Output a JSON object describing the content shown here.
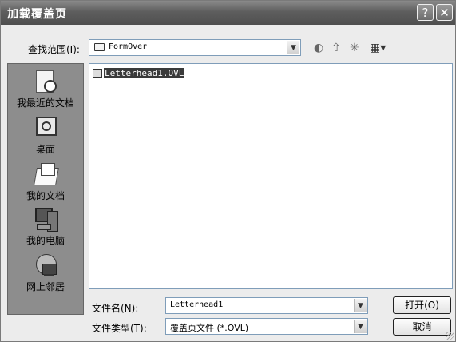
{
  "window": {
    "title": "加载覆盖页",
    "help_label": "?",
    "close_label": "✕"
  },
  "lookin": {
    "label": "查找范围(I):",
    "value": "FormOver"
  },
  "toolbar": {
    "back_glyph": "◐",
    "up_glyph": "⇧",
    "newfolder_glyph": "✳",
    "views_glyph": "▦▾"
  },
  "places": [
    {
      "label": "我最近的文档",
      "icon": "recent-documents-icon"
    },
    {
      "label": "桌面",
      "icon": "desktop-icon"
    },
    {
      "label": "我的文档",
      "icon": "my-documents-icon"
    },
    {
      "label": "我的电脑",
      "icon": "my-computer-icon"
    },
    {
      "label": "网上邻居",
      "icon": "network-places-icon"
    }
  ],
  "files": [
    {
      "name": "Letterhead1.OVL"
    }
  ],
  "filename": {
    "label": "文件名(N):",
    "value": "Letterhead1"
  },
  "filetype": {
    "label": "文件类型(T):",
    "value": "覆盖页文件 (*.OVL)"
  },
  "buttons": {
    "open": "打开(O)",
    "cancel": "取消"
  }
}
